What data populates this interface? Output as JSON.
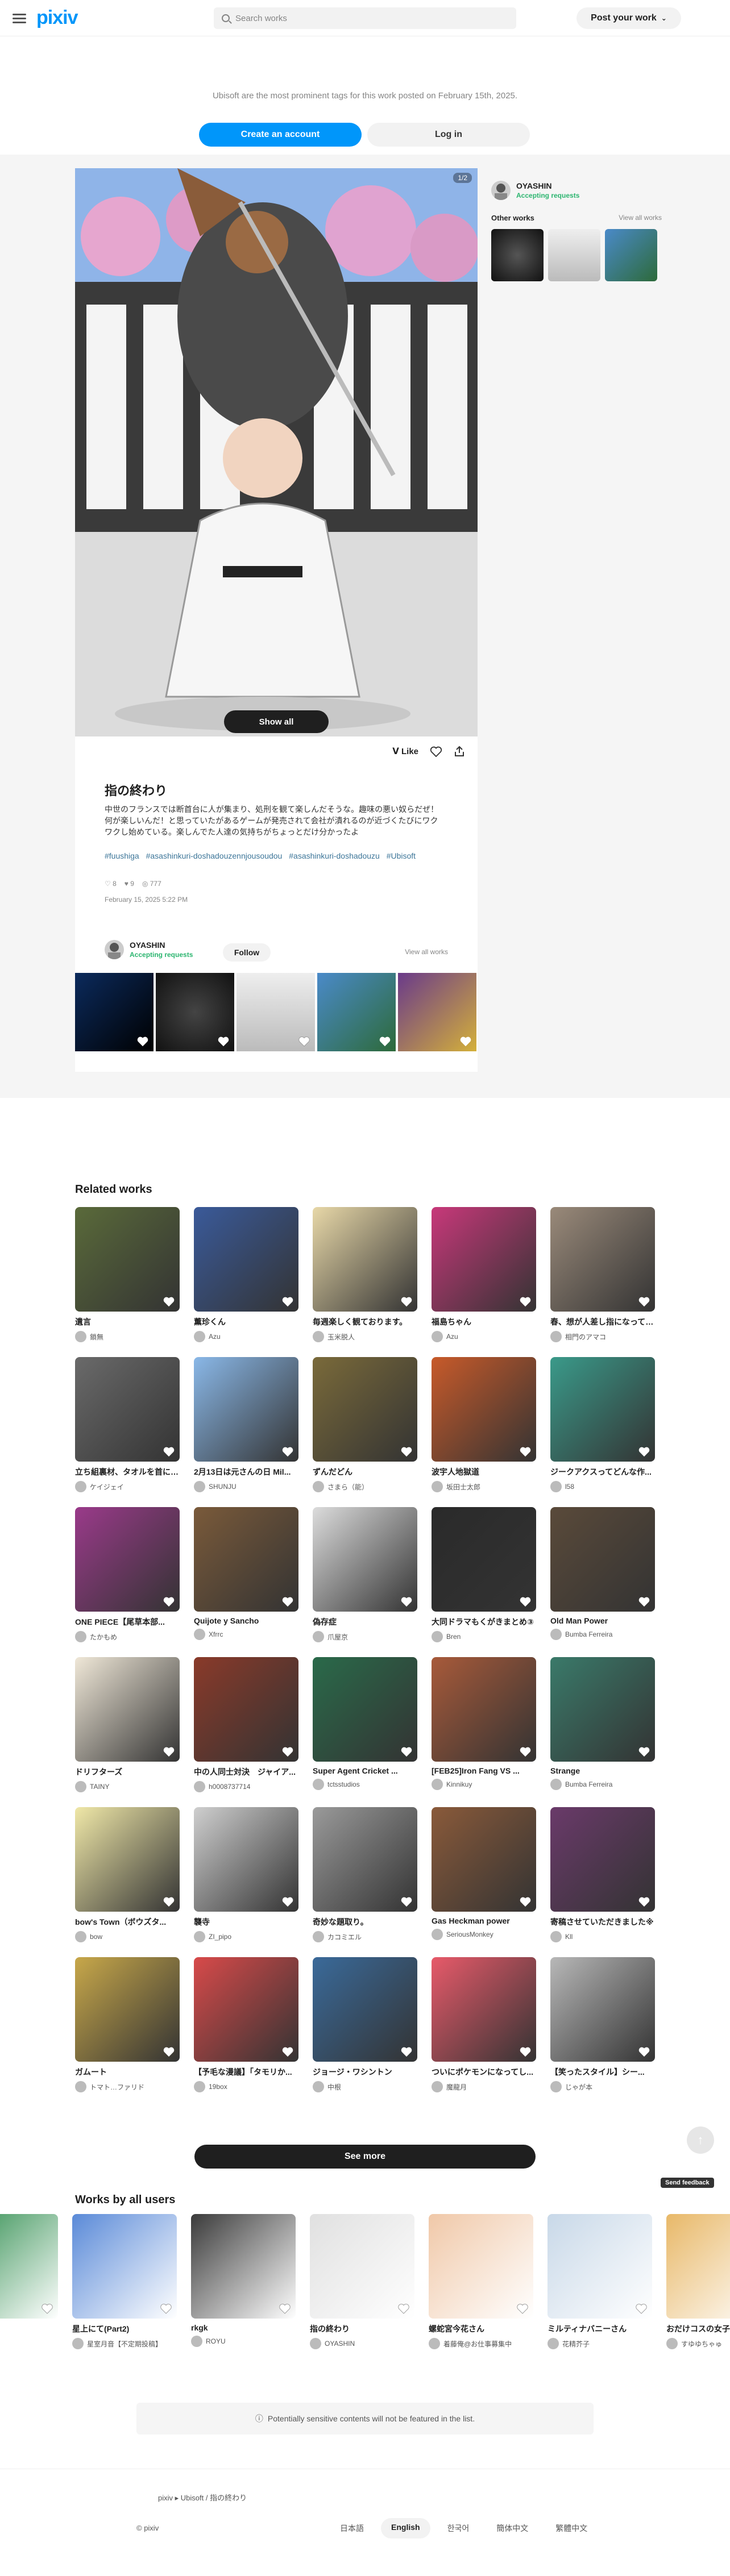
{
  "header": {
    "logo": "pixiv",
    "search_placeholder": "Search works",
    "post_label": "Post your work",
    "post_chevron": "⌄"
  },
  "promo": {
    "text": "Ubisoft are the most prominent tags for this work posted on February 15th, 2025.",
    "create": "Create an account",
    "login": "Log in"
  },
  "work": {
    "page_badge": "1/2",
    "show_all": "Show all",
    "like_label": "Like",
    "title": "指の終わり",
    "description": "中世のフランスでは断首台に人が集まり、処刑を観て楽しんだそうな。趣味の悪い奴らだぜ！何が楽しいんだ！と思っていたがあるゲームが発売されて会社が潰れるのが近づくたびにワクワクし始めている。楽しんでた人達の気持ちがちょっとだけ分かったよ",
    "tags": [
      "#fuushiga",
      "#asashinkuri-doshadouzennjousoudou",
      "#asashinkuri-doshadouzu",
      "#Ubisoft"
    ],
    "stats": {
      "likes": "8",
      "bookmarks": "9",
      "views": "777"
    },
    "date": "February 15, 2025 5:22 PM",
    "author": "OYASHIN",
    "accepting": "Accepting requests",
    "follow": "Follow",
    "view_all": "View all works"
  },
  "side": {
    "author": "OYASHIN",
    "accepting": "Accepting requests",
    "other_works": "Other works",
    "view_all": "View all works"
  },
  "related": {
    "heading": "Related works",
    "items": [
      {
        "title": "遺言",
        "user": "鎖無"
      },
      {
        "title": "薫珍くん",
        "user": "Azu"
      },
      {
        "title": "毎週楽しく観ております。",
        "user": "玉米脱人"
      },
      {
        "title": "福島ちゃん",
        "user": "Azu"
      },
      {
        "title": "春、想が人差し指になってる…",
        "user": "相門のアマコ"
      },
      {
        "title": "立ち組裏材、タオルを首に…",
        "user": "ケイジェイ"
      },
      {
        "title": "2月13日は元さんの日 Mil...",
        "user": "SHUNJU"
      },
      {
        "title": "ずんだどん",
        "user": "さまら（能）"
      },
      {
        "title": "波宇人地獄道",
        "user": "坂田士太郎"
      },
      {
        "title": "ジークアクスってどんな作...",
        "user": "l58"
      },
      {
        "title": "ONE PIECE【尾草本部...",
        "user": "たかもめ"
      },
      {
        "title": "Quijote y Sancho",
        "user": "Xfrrc"
      },
      {
        "title": "偽存症",
        "user": "爪屋京"
      },
      {
        "title": "大同ドラマもくがきまとめ③",
        "user": "Bren"
      },
      {
        "title": "Old Man Power",
        "user": "Bumba Ferreira"
      },
      {
        "title": "ドリフターズ",
        "user": "TAINY"
      },
      {
        "title": "中の人同士対決　ジャイア...",
        "user": "h0008737714"
      },
      {
        "title": "Super Agent Cricket ...",
        "user": "tctsstudios"
      },
      {
        "title": "[FEB25]Iron Fang VS ...",
        "user": "Kinnikuy"
      },
      {
        "title": "Strange",
        "user": "Bumba Ferreira"
      },
      {
        "title": "bow's Town（ボウズタ...",
        "user": "bow"
      },
      {
        "title": "襲寺",
        "user": "ZI_pipo"
      },
      {
        "title": "奇妙な題取り。",
        "user": "カコミエル"
      },
      {
        "title": "Gas Heckman power",
        "user": "SeriousMonkey"
      },
      {
        "title": "寄稿させていただきました※",
        "user": "Kll"
      },
      {
        "title": "ガムート",
        "user": "トマト…ファリド"
      },
      {
        "title": "【予毛な漫議】「タモリか...",
        "user": "19box"
      },
      {
        "title": "ジョージ・ワシントン",
        "user": "中根"
      },
      {
        "title": "ついにポケモンになってし...",
        "user": "魔龍月"
      },
      {
        "title": "【笑ったスタイル】シー...",
        "user": "じゃが本"
      }
    ],
    "see_more": "See more"
  },
  "all_users": {
    "heading": "Works by all users",
    "items": [
      {
        "title": "ブ",
        "user": ""
      },
      {
        "title": "星上にて(Part2)",
        "user": "星室月音【不定期投稿】"
      },
      {
        "title": "rkgk",
        "user": "ROYU"
      },
      {
        "title": "指の終わり",
        "user": "OYASHIN"
      },
      {
        "title": "螺蛇宮今花さん",
        "user": "着藤俺@お仕事募集中"
      },
      {
        "title": "ミルティナバニーさん",
        "user": "花精芥子"
      },
      {
        "title": "おだけコスの女子",
        "user": "すゆゆちゃゅ"
      }
    ]
  },
  "to_top": "↑",
  "feedback": "Send feedback",
  "notice": "Potentially sensitive contents will not be featured in the list.",
  "footer": {
    "breadcrumb": [
      "pixiv",
      "Ubisoft",
      "指の終わり"
    ],
    "copyright": "© pixiv",
    "languages": [
      "日本語",
      "English",
      "한국어",
      "簡体中文",
      "繁體中文"
    ],
    "active_language": "English"
  }
}
